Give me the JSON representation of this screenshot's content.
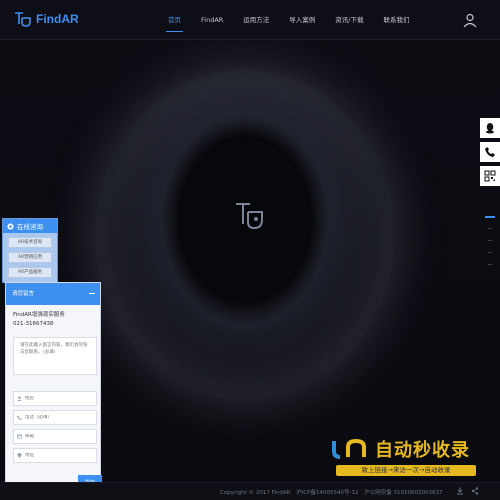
{
  "brand": {
    "name": "FindAR",
    "color": "#3d8ff0"
  },
  "nav": {
    "items": [
      {
        "label": "首页",
        "active": true
      },
      {
        "label": "FindAR",
        "active": false
      },
      {
        "label": "运用方法",
        "active": false
      },
      {
        "label": "导入案例",
        "active": false
      },
      {
        "label": "资讯/下载",
        "active": false
      },
      {
        "label": "联系我们",
        "active": false
      }
    ],
    "user_icon": "user-icon"
  },
  "right_float": {
    "icons": [
      "qq-icon",
      "phone-icon",
      "qrcode-icon"
    ]
  },
  "consult": {
    "title": "在线咨询",
    "items": [
      "AR技术咨询",
      "AR营销应用",
      "AR产品服务"
    ]
  },
  "message": {
    "title": "请您留言",
    "service_name": "FindAR增强现实服务",
    "phone": "021-31667438",
    "content_placeholder": "请在此输入留言内容，我们会尽快与您联系。（必填）",
    "name_placeholder": "姓名",
    "tel_placeholder": "电话（必填）",
    "email_placeholder": "邮箱",
    "address_placeholder": "地址",
    "submit_label": "提交"
  },
  "watermark": {
    "title": "自动秒收录",
    "subtitle": "致上链接→来访一次→自动收录"
  },
  "footer": {
    "copyright": "Copyright © 2017 FindAR",
    "icp": "沪ICP备14005540号-12",
    "police": "沪公网安备 31010602003637"
  }
}
